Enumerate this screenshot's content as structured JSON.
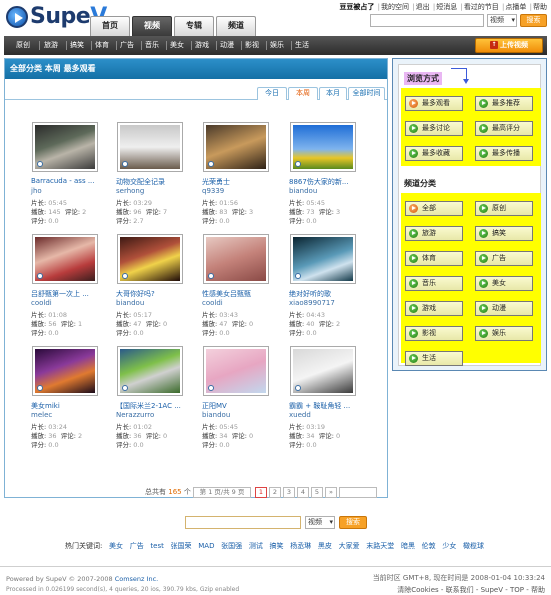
{
  "header": {
    "logo_text_main": "Supe",
    "logo_text_v": "V",
    "top_links": {
      "user": "豆豆被占了",
      "links": [
        "我的空间",
        "退出",
        "短消息",
        "看过的节目",
        "点播单",
        "帮助"
      ]
    },
    "search": {
      "placeholder": "",
      "select": "视频",
      "button": "搜索"
    },
    "tabs": [
      {
        "label": "首页",
        "active": false
      },
      {
        "label": "视频",
        "active": true
      },
      {
        "label": "专辑",
        "active": false
      },
      {
        "label": "频道",
        "active": false
      }
    ]
  },
  "nav": {
    "items": [
      "原创",
      "旅游",
      "搞笑",
      "体育",
      "广告",
      "音乐",
      "美女",
      "游戏",
      "动漫",
      "影视",
      "娱乐",
      "生活"
    ],
    "upload_label": "上传视频"
  },
  "main": {
    "heading": "全部分类 本周 最多观看",
    "time_tabs": [
      {
        "label": "今日",
        "active": false
      },
      {
        "label": "本周",
        "active": true
      },
      {
        "label": "本月",
        "active": false
      },
      {
        "label": "全部时间",
        "active": false
      }
    ],
    "labels": {
      "length": "片长:",
      "plays": "播放:",
      "comments": "评论:",
      "rating": "评分:"
    },
    "videos": [
      {
        "title": "Barracuda - ass ...",
        "user": "jho",
        "length": "05:45",
        "plays": "145",
        "comments": "2",
        "rating": "0.0"
      },
      {
        "title": "动物交配全记录",
        "user": "serhong",
        "length": "03:29",
        "plays": "96",
        "comments": "7",
        "rating": "2.7"
      },
      {
        "title": "光荣勇士",
        "user": "q9339",
        "length": "01:56",
        "plays": "83",
        "comments": "3",
        "rating": "0.0"
      },
      {
        "title": "8867伤大家的新...",
        "user": "biandou",
        "length": "05:45",
        "plays": "73",
        "comments": "3",
        "rating": "0.0"
      },
      {
        "title": "吕舒甄第一次上 ...",
        "user": "cooldi",
        "length": "01:08",
        "plays": "56",
        "comments": "1",
        "rating": "0.0"
      },
      {
        "title": "大哥你好吗?",
        "user": "biandou",
        "length": "05:17",
        "plays": "47",
        "comments": "0",
        "rating": "0.0"
      },
      {
        "title": "性感美女吕甄甄",
        "user": "cooldi",
        "length": "03:43",
        "plays": "47",
        "comments": "0",
        "rating": "0.0"
      },
      {
        "title": "绝对好听的歌",
        "user": "xiao8990717",
        "length": "04:43",
        "plays": "40",
        "comments": "2",
        "rating": "0.0"
      },
      {
        "title": "美女miki",
        "user": "melec",
        "length": "03:24",
        "plays": "36",
        "comments": "2",
        "rating": "0.0"
      },
      {
        "title": "【国际米兰2-1AC ...",
        "user": "Nerazzurro",
        "length": "01:02",
        "plays": "36",
        "comments": "0",
        "rating": "0.0"
      },
      {
        "title": "正阳MV",
        "user": "biandou",
        "length": "05:45",
        "plays": "34",
        "comments": "0",
        "rating": "0.0"
      },
      {
        "title": "霸霸 + 鞍耻角轻 ...",
        "user": "xuedd",
        "length": "03:19",
        "plays": "34",
        "comments": "0",
        "rating": "0.0"
      }
    ],
    "pager": {
      "total_prefix": "总共有",
      "total": "165",
      "total_suffix": "个",
      "page_info": "第 1 页/共 9 页",
      "pages": [
        "1",
        "2",
        "3",
        "4",
        "5"
      ],
      "current": "1",
      "next": "»"
    }
  },
  "sidebar": {
    "browse_title": "浏览方式",
    "browse": [
      "最多观看",
      "最多推荐",
      "最多讨论",
      "最高评分",
      "最多收藏",
      "最多传播"
    ],
    "category_title": "频道分类",
    "categories": [
      "全部",
      "原创",
      "旅游",
      "搞笑",
      "体育",
      "广告",
      "音乐",
      "美女",
      "游戏",
      "动漫",
      "影视",
      "娱乐",
      "生活"
    ]
  },
  "bottom_search": {
    "placeholder": "",
    "select": "视频",
    "button": "搜索"
  },
  "hotwords": {
    "label": "热门关键词:",
    "words": [
      "美女",
      "广告",
      "test",
      "张国荣",
      "MAD",
      "张国强",
      "测试",
      "搞笑",
      "杨丞琳",
      "黑皮",
      "大家爱",
      "末路天堂",
      "暗黑",
      "伦敦",
      "少女",
      "橄榄球"
    ]
  },
  "footer": {
    "powered": "Powered by SupeV © 2007-2008",
    "company": "Comsenz Inc.",
    "processed": "Processed in 0.026199 second(s), 4 queries, 20 ios, 390.79 kbs, Gzip enabled",
    "time": "当前时区 GMT+8, 现在时间是 2008-01-04 10:33:24",
    "links": "清除Cookies - 联系我们 - SupeV - TOP - 帮助"
  },
  "colors": {
    "header_blue": "#1470a6",
    "accent_orange": "#f7a126",
    "sidebar_highlight": "#ffff00",
    "browse_title_bg": "#e9b7f3"
  }
}
